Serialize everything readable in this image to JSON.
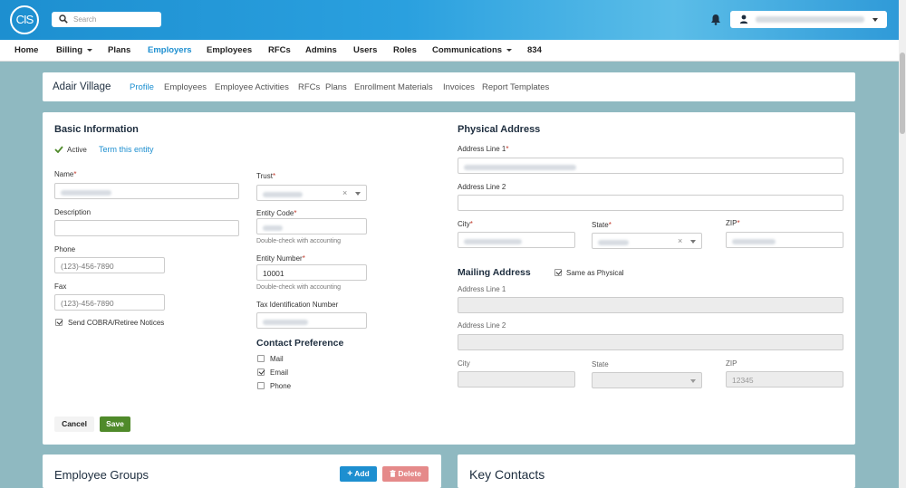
{
  "topbar": {
    "logo": "CIS",
    "search_placeholder": "Search",
    "colors": {
      "brand": "#1d8fd0"
    }
  },
  "nav": {
    "items": [
      {
        "label": "Home"
      },
      {
        "label": "Billing"
      },
      {
        "label": "Plans"
      },
      {
        "label": "Employers"
      },
      {
        "label": "Employees"
      },
      {
        "label": "RFCs"
      },
      {
        "label": "Admins"
      },
      {
        "label": "Users"
      },
      {
        "label": "Roles"
      },
      {
        "label": "Communications"
      },
      {
        "label": "834"
      }
    ],
    "active": "Employers"
  },
  "entity": {
    "name": "Adair Village",
    "tabs": [
      {
        "label": "Profile"
      },
      {
        "label": "Employees"
      },
      {
        "label": "Employee Activities"
      },
      {
        "label": "RFCs"
      },
      {
        "label": "Plans"
      },
      {
        "label": "Enrollment Materials"
      },
      {
        "label": "Invoices"
      },
      {
        "label": "Report Templates"
      }
    ],
    "active_tab": "Profile"
  },
  "basic": {
    "title": "Basic Information",
    "status": "Active",
    "term_link": "Term this entity",
    "name_label": "Name",
    "description_label": "Description",
    "phone_label": "Phone",
    "phone_placeholder": "(123)-456-7890",
    "fax_label": "Fax",
    "fax_placeholder": "(123)-456-7890",
    "cobra_label": "Send COBRA/Retiree Notices",
    "trust_label": "Trust",
    "entity_code_label": "Entity Code",
    "entity_code_hint": "Double-check with accounting",
    "entity_number_label": "Entity Number",
    "entity_number_value": "10001",
    "entity_number_hint": "Double-check with accounting",
    "tax_id_label": "Tax Identification Number",
    "required_mark": "*"
  },
  "contact_pref": {
    "title": "Contact Preference",
    "options": [
      {
        "label": "Mail",
        "checked": false
      },
      {
        "label": "Email",
        "checked": true
      },
      {
        "label": "Phone",
        "checked": false
      }
    ]
  },
  "physical": {
    "title": "Physical Address",
    "line1_label": "Address Line 1",
    "line2_label": "Address Line 2",
    "city_label": "City",
    "state_label": "State",
    "zip_label": "ZIP"
  },
  "mailing": {
    "title": "Mailing Address",
    "same_label": "Same as Physical",
    "line1_label": "Address Line 1",
    "line2_label": "Address Line 2",
    "city_label": "City",
    "state_label": "State",
    "zip_label": "ZIP",
    "zip_placeholder": "12345"
  },
  "actions": {
    "cancel": "Cancel",
    "save": "Save"
  },
  "employee_groups": {
    "title": "Employee Groups",
    "add": "Add",
    "delete": "Delete"
  },
  "key_contacts": {
    "title": "Key Contacts"
  }
}
